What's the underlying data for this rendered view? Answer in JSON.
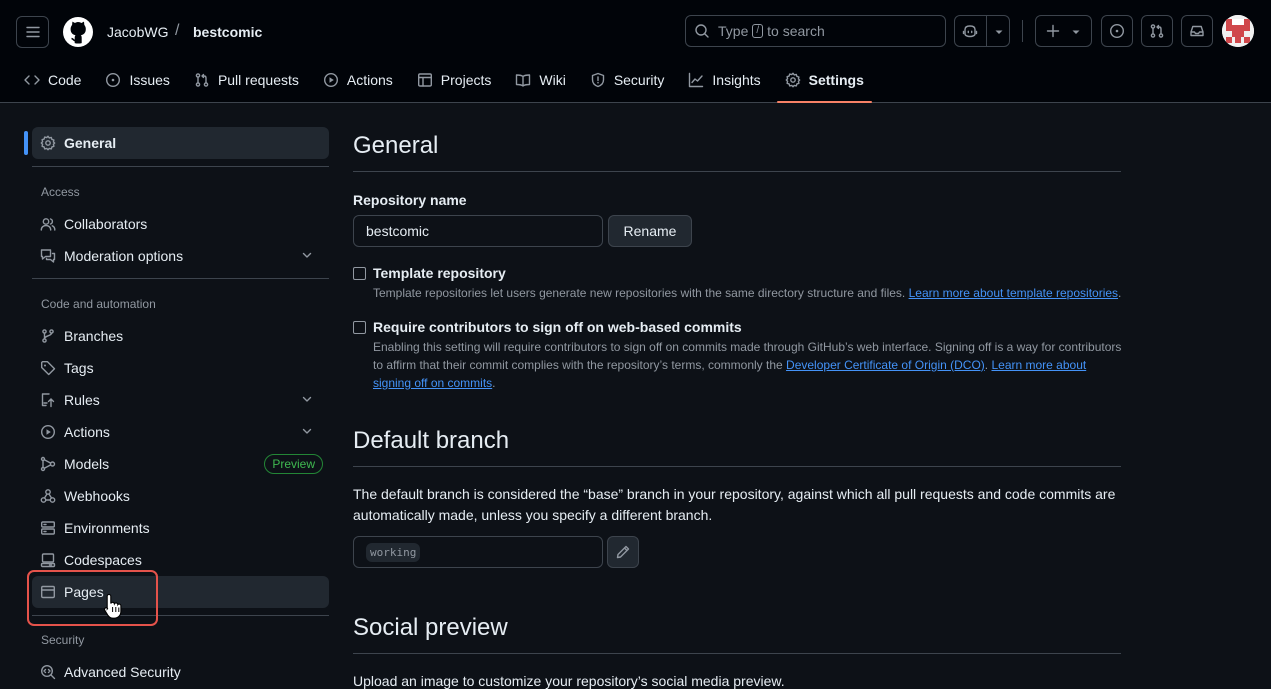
{
  "header": {
    "owner": "JacobWG",
    "separator": "/",
    "repo": "bestcomic",
    "search_prefix": "Type",
    "search_key": "/",
    "search_suffix": "to search"
  },
  "tabs": [
    {
      "label": "Code",
      "icon": "code-icon"
    },
    {
      "label": "Issues",
      "icon": "issue-opened-icon"
    },
    {
      "label": "Pull requests",
      "icon": "git-pull-request-icon"
    },
    {
      "label": "Actions",
      "icon": "play-icon"
    },
    {
      "label": "Projects",
      "icon": "table-icon"
    },
    {
      "label": "Wiki",
      "icon": "book-icon"
    },
    {
      "label": "Security",
      "icon": "shield-icon"
    },
    {
      "label": "Insights",
      "icon": "graph-icon"
    },
    {
      "label": "Settings",
      "icon": "gear-icon",
      "active": true
    }
  ],
  "sidebar": {
    "general": "General",
    "access_heading": "Access",
    "collaborators": "Collaborators",
    "moderation": "Moderation options",
    "code_heading": "Code and automation",
    "branches": "Branches",
    "tags": "Tags",
    "rules": "Rules",
    "actions": "Actions",
    "models": "Models",
    "models_badge": "Preview",
    "webhooks": "Webhooks",
    "environments": "Environments",
    "codespaces": "Codespaces",
    "pages": "Pages",
    "security_heading": "Security",
    "advanced_security": "Advanced Security"
  },
  "main": {
    "title": "General",
    "repo_name_label": "Repository name",
    "repo_name_value": "bestcomic",
    "rename_button": "Rename",
    "template_label": "Template repository",
    "template_note": "Template repositories let users generate new repositories with the same directory structure and files.",
    "template_link": "Learn more about template repositories",
    "template_note_end": ".",
    "signoff_label": "Require contributors to sign off on web-based commits",
    "signoff_note_1": "Enabling this setting will require contributors to sign off on commits made through GitHub’s web interface. Signing off is a way for contributors to affirm that their commit complies with the repository’s terms, commonly the",
    "signoff_link_1": "Developer Certificate of Origin (DCO)",
    "signoff_note_2": ".",
    "signoff_link_2": "Learn more about signing off on commits",
    "signoff_note_end": ".",
    "default_branch_title": "Default branch",
    "default_branch_desc": "The default branch is considered the “base” branch in your repository, against which all pull requests and code commits are automatically made, unless you specify a different branch.",
    "default_branch_value": "working",
    "social_title": "Social preview",
    "social_desc": "Upload an image to customize your repository’s social media preview."
  },
  "colors": {
    "accent": "#4493f8",
    "active_tab_underline": "#f78166",
    "highlight_box": "#e5534b",
    "badge_green": "#3fb950"
  }
}
